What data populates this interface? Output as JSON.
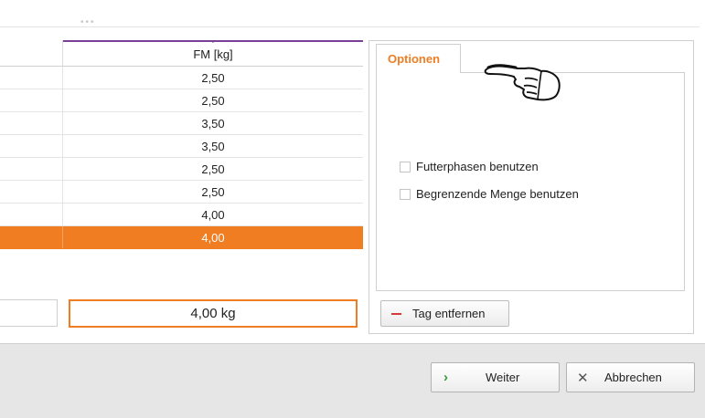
{
  "table": {
    "column_header": "FM [kg]",
    "rows": [
      "2,50",
      "2,50",
      "3,50",
      "3,50",
      "2,50",
      "2,50",
      "4,00",
      "4,00"
    ],
    "selected_row_index": 7
  },
  "editor": {
    "value": "4,00 kg"
  },
  "options": {
    "tab_label": "Optionen",
    "checkboxes": [
      {
        "label": "Futterphasen benutzen",
        "checked": false
      },
      {
        "label": "Begrenzende Menge benutzen",
        "checked": false
      }
    ]
  },
  "actions": {
    "remove_day_label": "Tag entfernen"
  },
  "footer": {
    "next_label": "Weiter",
    "cancel_label": "Abbrechen"
  },
  "icons": {
    "pointer": "pointing-hand-icon",
    "remove": "minus-icon",
    "next": "chevron-right-icon",
    "cancel": "close-icon"
  },
  "colors": {
    "accent": "#f07d22",
    "header_accent": "#7b3f98",
    "remove": "#d43a3a",
    "next": "#2e9d3a"
  }
}
